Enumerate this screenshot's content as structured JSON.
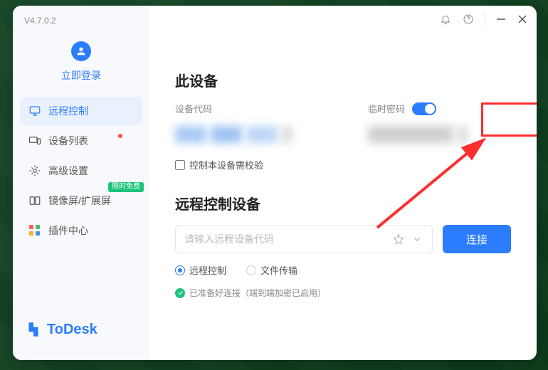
{
  "app": {
    "version": "V4.7.0.2",
    "brand": "ToDesk"
  },
  "profile": {
    "login_text": "立即登录"
  },
  "nav": {
    "items": [
      {
        "label": "远程控制",
        "icon": "monitor"
      },
      {
        "label": "设备列表",
        "icon": "devices",
        "dot": true
      },
      {
        "label": "高级设置",
        "icon": "settings"
      },
      {
        "label": "镜像屏/扩展屏",
        "icon": "mirror",
        "badge": "限时免费"
      },
      {
        "label": "插件中心",
        "icon": "plugin"
      }
    ]
  },
  "main": {
    "this_device_title": "此设备",
    "device_code_label": "设备代码",
    "temp_password_label": "临时密码",
    "temp_password_on": true,
    "checkbox_label": "控制本设备需校验",
    "remote_title": "远程控制设备",
    "input_placeholder": "请输入远程设备代码",
    "connect_label": "连接",
    "radio_remote": "远程控制",
    "radio_file": "文件传输",
    "status_text": "已准备好连接（端到端加密已启用）"
  }
}
